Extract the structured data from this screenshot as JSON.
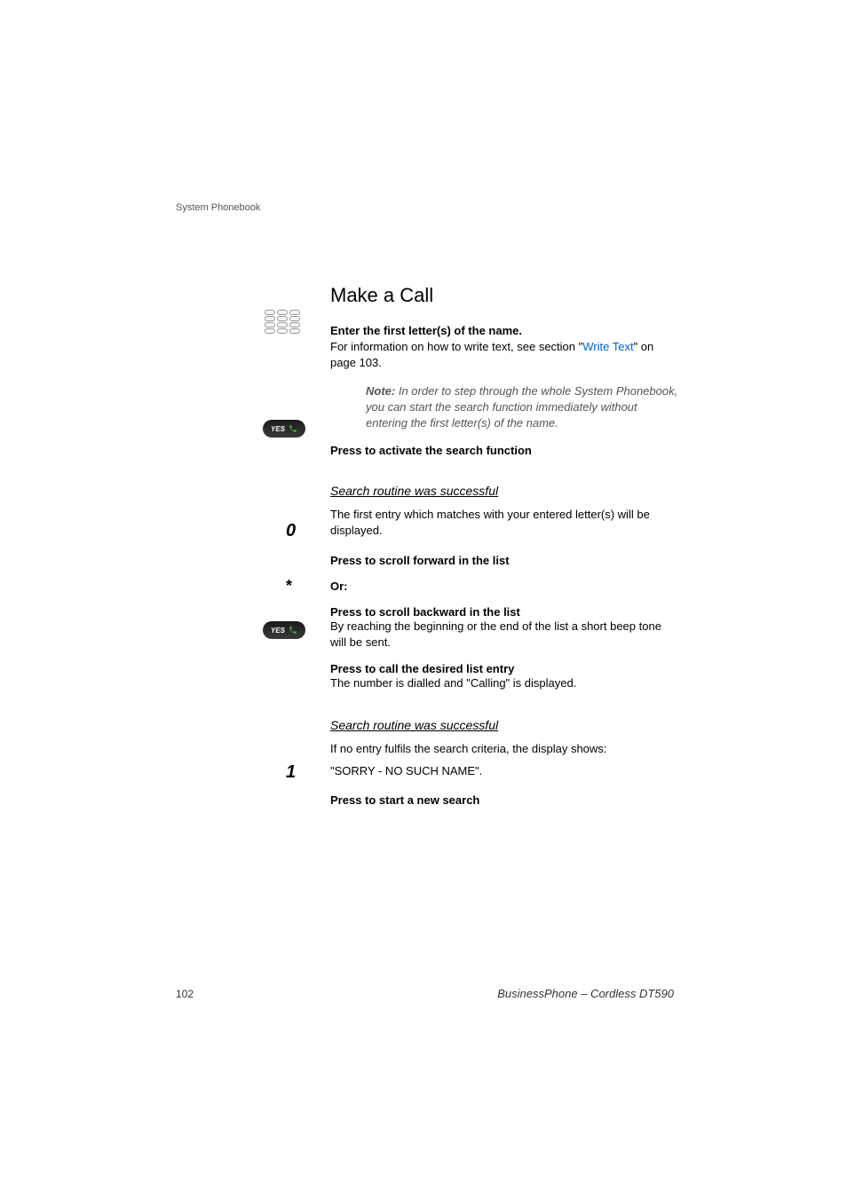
{
  "header": "System Phonebook",
  "title": "Make a Call",
  "step1": {
    "bold": "Enter the first letter(s) of the name.",
    "text_pre": "For information on how to write text, see section \"",
    "link": "Write Text",
    "text_post": "\" on page 103."
  },
  "note": {
    "label": "Note: ",
    "text": "In order to step through the whole System Phonebook, you can start the search function immediately without entering the first letter(s) of the name."
  },
  "yes_label": "YES",
  "step2": "Press to activate the search function",
  "sub1_title": "Search routine was successful",
  "sub1_text": "The first entry which matches with your entered letter(s) will be displayed.",
  "key0": "0",
  "step3": "Press to scroll forward in the list",
  "or_text": "Or:",
  "key_star": "*",
  "step4_bold": "Press to scroll backward in the list",
  "step4_text": "By reaching the beginning or the end of the list a short beep tone will be sent.",
  "step5_bold": "Press to call the desired list entry",
  "step5_text": "The number is dialled and \"Calling\" is displayed.",
  "sub2_title": "Search routine was successful",
  "sub2_text1": "If no entry fulfils the search criteria, the display shows:",
  "sub2_text2": "\"SORRY - NO SUCH NAME\".",
  "key1": "1",
  "step6": "Press to start a new search",
  "footer_page": "102",
  "footer_model": "BusinessPhone – Cordless DT590"
}
